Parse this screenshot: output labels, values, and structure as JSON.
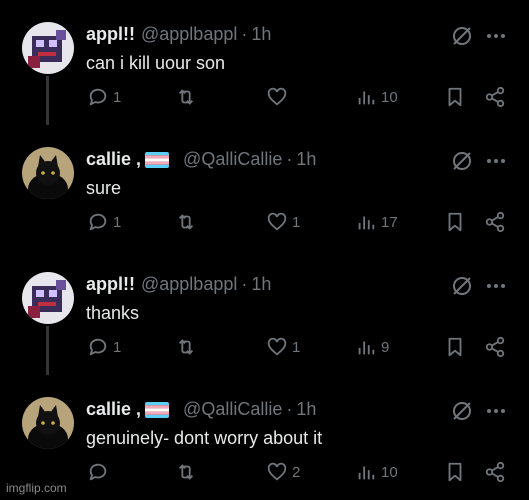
{
  "tweets": [
    {
      "name": "appl!!",
      "handle": "@applbappl",
      "sep": "·",
      "time": "1h",
      "text": "can i kill uour son",
      "has_flag": false,
      "avatar": "robot-avatar",
      "replies": "1",
      "retweets": "",
      "likes": "",
      "views": "10"
    },
    {
      "name": "callie ,",
      "handle": "@QalliCallie",
      "sep": "·",
      "time": "1h",
      "text": "sure",
      "has_flag": true,
      "avatar": "black-cat-avatar",
      "replies": "1",
      "retweets": "",
      "likes": "1",
      "views": "17"
    },
    {
      "name": "appl!!",
      "handle": "@applbappl",
      "sep": "·",
      "time": "1h",
      "text": "thanks",
      "has_flag": false,
      "avatar": "robot-avatar",
      "replies": "1",
      "retweets": "",
      "likes": "1",
      "views": "9"
    },
    {
      "name": "callie ,",
      "handle": "@QalliCallie",
      "sep": "·",
      "time": "1h",
      "text": "genuinely- dont worry about it",
      "has_flag": true,
      "avatar": "black-cat-avatar",
      "replies": "",
      "retweets": "",
      "likes": "2",
      "views": "10"
    }
  ],
  "flag_colors": [
    "#5BCEFA",
    "#F5A9B8",
    "#FFFFFF",
    "#F5A9B8",
    "#5BCEFA"
  ],
  "watermark": "imgflip.com"
}
